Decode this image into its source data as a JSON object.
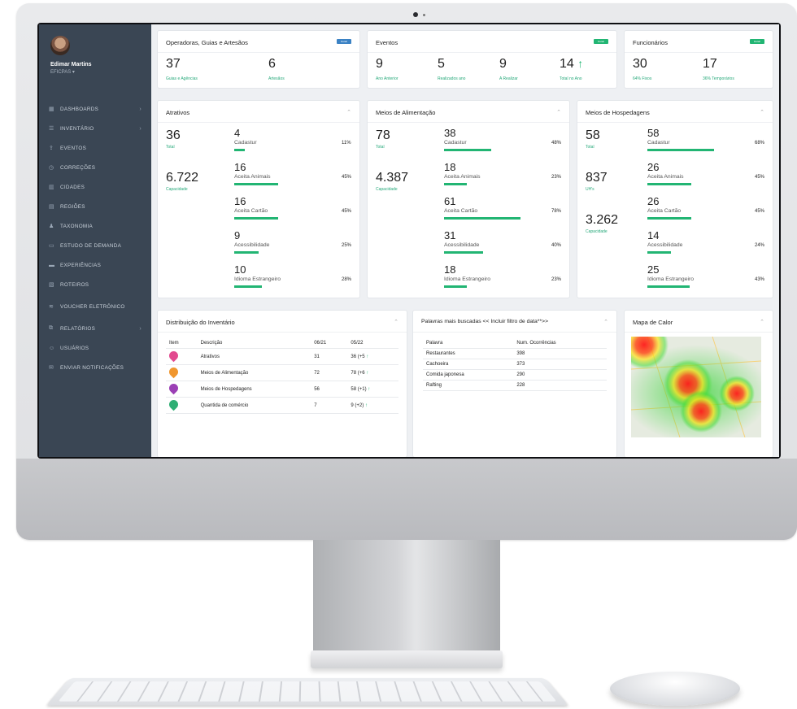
{
  "user": {
    "name": "Edimar Martins",
    "role": "EFICPAS ▾"
  },
  "menu": [
    {
      "label": "DASHBOARDS",
      "icon": "chart-icon",
      "chevron": true
    },
    {
      "label": "INVENTÁRIO",
      "icon": "list-icon",
      "chevron": true
    },
    {
      "label": "EVENTOS",
      "icon": "upload-icon",
      "chevron": false
    },
    {
      "label": "CORREÇÕES",
      "icon": "clock-icon",
      "chevron": false
    },
    {
      "label": "CIDADES",
      "icon": "building-icon",
      "chevron": false
    },
    {
      "label": "REGIÕES",
      "icon": "grid-icon",
      "chevron": false
    },
    {
      "label": "TAXONOMIA",
      "icon": "person-icon",
      "chevron": false
    },
    {
      "label": "ESTUDO DE DEMANDA",
      "icon": "monitor-icon",
      "chevron": false
    },
    {
      "label": "EXPERIÊNCIAS",
      "icon": "card-icon",
      "chevron": false
    },
    {
      "label": "ROTEIROS",
      "icon": "map-icon",
      "chevron": false
    },
    {
      "label": "VOUCHER ELETRÔNICO",
      "icon": "ticket-icon",
      "chevron": false
    },
    {
      "label": "RELATÓRIOS",
      "icon": "report-icon",
      "chevron": true
    },
    {
      "label": "USUÁRIOS",
      "icon": "users-icon",
      "chevron": false
    },
    {
      "label": "ENVIAR NOTIFICAÇÕES",
      "icon": "mail-icon",
      "chevron": false
    }
  ],
  "colors": {
    "accent": "#22b573",
    "sidebar": "#3a4654",
    "blue_badge": "#3b82c4"
  },
  "operadoras": {
    "title": "Operadoras, Guias e Artesãos",
    "s1_value": "37",
    "s1_label": "Guias e Agências",
    "s2_value": "6",
    "s2_label": "Artesãos"
  },
  "eventos": {
    "title": "Eventos",
    "s1_value": "9",
    "s1_label": "Ano Anterior",
    "s2_value": "5",
    "s2_label": "Realizados ano",
    "s3_value": "9",
    "s3_label": "A Realizar",
    "s4_value": "14",
    "s4_label": "Total no Ano"
  },
  "funcionarios": {
    "title": "Funcionários",
    "s1_value": "30",
    "s1_label": "64% Fixos",
    "s2_value": "17",
    "s2_label": "36% Temporários"
  },
  "atrativos": {
    "title": "Atrativos",
    "total_value": "36",
    "total_label": "Total",
    "cap_value": "6.722",
    "cap_label": "Capacidade",
    "items": [
      {
        "value": "4",
        "label": "Cadastur",
        "pct": "11%",
        "fill": 0.11
      },
      {
        "value": "16",
        "label": "Aceita Animais",
        "pct": "45%",
        "fill": 0.45
      },
      {
        "value": "16",
        "label": "Aceita Cartão",
        "pct": "45%",
        "fill": 0.45
      },
      {
        "value": "9",
        "label": "Acessibilidade",
        "pct": "25%",
        "fill": 0.25
      },
      {
        "value": "10",
        "label": "Idioma Estrangeiro",
        "pct": "28%",
        "fill": 0.28
      }
    ]
  },
  "alimentacao": {
    "title": "Meios de Alimentação",
    "total_value": "78",
    "total_label": "Total",
    "cap_value": "4.387",
    "cap_label": "Capacidade",
    "items": [
      {
        "value": "38",
        "label": "Cadastur",
        "pct": "48%",
        "fill": 0.48
      },
      {
        "value": "18",
        "label": "Aceita Animais",
        "pct": "23%",
        "fill": 0.23
      },
      {
        "value": "61",
        "label": "Aceita Cartão",
        "pct": "78%",
        "fill": 0.78
      },
      {
        "value": "31",
        "label": "Acessibilidade",
        "pct": "40%",
        "fill": 0.4
      },
      {
        "value": "18",
        "label": "Idioma Estrangeiro",
        "pct": "23%",
        "fill": 0.23
      }
    ]
  },
  "hospedagem": {
    "title": "Meios de Hospedagens",
    "total_value": "58",
    "total_label": "Total",
    "uh_value": "837",
    "uh_label": "UH's",
    "cap_value": "3.262",
    "cap_label": "Capacidade",
    "items": [
      {
        "value": "58",
        "label": "Cadastur",
        "pct": "68%",
        "fill": 0.68
      },
      {
        "value": "26",
        "label": "Aceita Animais",
        "pct": "45%",
        "fill": 0.45
      },
      {
        "value": "26",
        "label": "Aceita Cartão",
        "pct": "45%",
        "fill": 0.45
      },
      {
        "value": "14",
        "label": "Acessibilidade",
        "pct": "24%",
        "fill": 0.24
      },
      {
        "value": "25",
        "label": "Idioma Estrangeiro",
        "pct": "43%",
        "fill": 0.43
      }
    ]
  },
  "inventario": {
    "title": "Distribuição do Inventário",
    "headers": [
      "Item",
      "Descrição",
      "06/21",
      "05/22"
    ],
    "rows": [
      {
        "pin_color": "#e24a8f",
        "desc": "Atrativos",
        "prev": "31",
        "curr": "36 (+5",
        "trend": "↑"
      },
      {
        "pin_color": "#f0962e",
        "desc": "Meios de Alimentação",
        "prev": "72",
        "curr": "78 (+6",
        "trend": "↑"
      },
      {
        "pin_color": "#9b3fb5",
        "desc": "Meios de Hospedagens",
        "prev": "56",
        "curr": "58 (+1)",
        "trend": "↑"
      },
      {
        "pin_color": "#2fae74",
        "desc": "Quantida de comércio",
        "prev": "7",
        "curr": "9 (+2)",
        "trend": "↑"
      }
    ]
  },
  "palavras": {
    "title": "Palavras mais buscadas << Incluir filtro de data**>>",
    "headers": [
      "Palavra",
      "Num. Ocorrências"
    ],
    "rows": [
      {
        "word": "Restaurantes",
        "count": "398"
      },
      {
        "word": "Cachoeira",
        "count": "373"
      },
      {
        "word": "Comida japonesa",
        "count": "290"
      },
      {
        "word": "Rafting",
        "count": "228"
      }
    ]
  },
  "mapa": {
    "title": "Mapa de Calor"
  }
}
